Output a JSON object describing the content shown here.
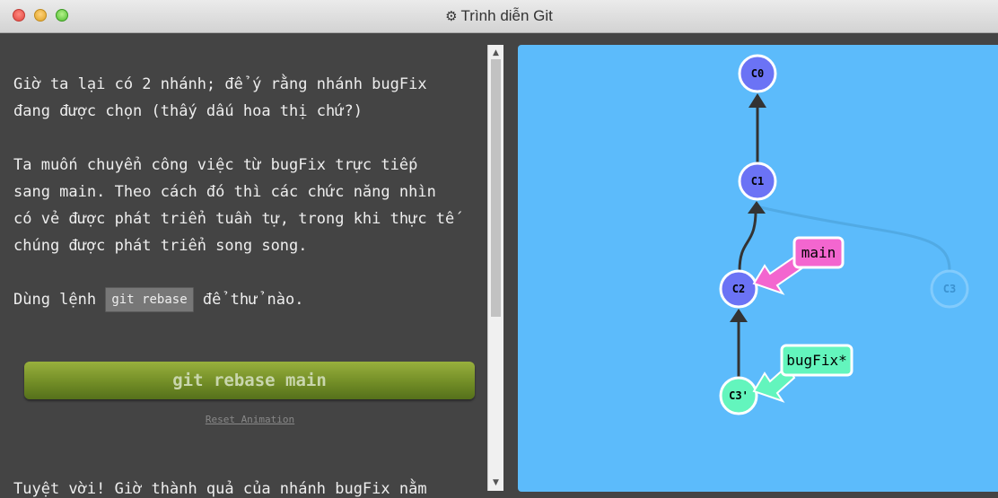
{
  "window": {
    "title": "Trình diễn Git",
    "title_icon": "gear-icon"
  },
  "instructions": {
    "para1": "Giờ ta lại có 2 nhánh; để ý rằng nhánh bugFix\nđang được chọn (thấy dấu hoa thị chứ?)",
    "para2": "Ta muốn chuyển công việc từ bugFix trực tiếp\nsang main. Theo cách đó thì các chức năng nhìn\ncó vẻ được phát triển tuần tự, trong khi thực tế\nchúng được phát triển song song.",
    "para3_prefix": "Dùng lệnh ",
    "para3_code": "git rebase",
    "para3_suffix": " để thử nào.",
    "command_button": "git rebase main",
    "reset_link": "Reset Animation",
    "para4_partial": "Tuyệt vời! Giờ thành quả của nhánh bugFix nằm"
  },
  "graph": {
    "background": "#5cbbfb",
    "commits": [
      {
        "id": "C0",
        "label": "C0",
        "color": "#6b73f5"
      },
      {
        "id": "C1",
        "label": "C1",
        "color": "#6b73f5"
      },
      {
        "id": "C2",
        "label": "C2",
        "color": "#6b73f5"
      },
      {
        "id": "C3",
        "label": "C3",
        "color": "#5cbbfb",
        "faded": true
      },
      {
        "id": "C3'",
        "label": "C3'",
        "color": "#63f5bd"
      }
    ],
    "branches": [
      {
        "name": "main",
        "label": "main",
        "target": "C2",
        "color": "#f366cf"
      },
      {
        "name": "bugFix",
        "label": "bugFix*",
        "target": "C3'",
        "color": "#63f5bd"
      }
    ]
  }
}
